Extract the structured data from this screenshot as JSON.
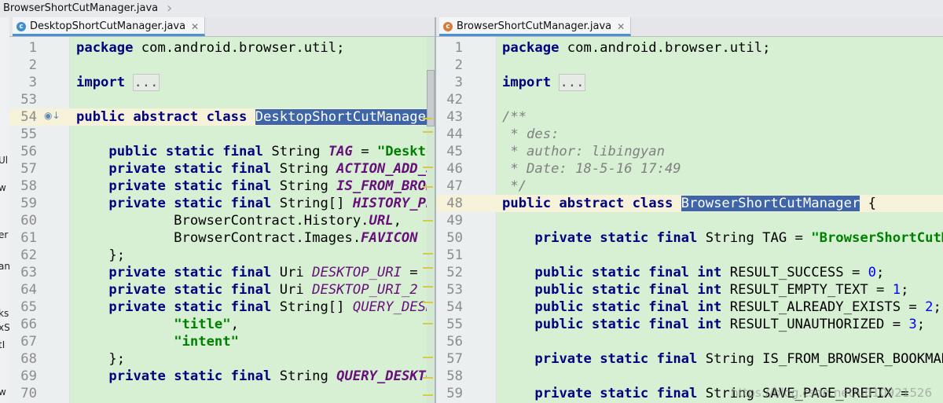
{
  "breadcrumb": {
    "file": "BrowserShortCutManager.java"
  },
  "left": {
    "tab": "DesktopShortCutManager.java",
    "lines": [
      {
        "n": "1",
        "html": "<span class=\"kw\">package</span> com.android.browser.util;"
      },
      {
        "n": "2",
        "html": ""
      },
      {
        "n": "3",
        "html": "<span class=\"kw\">import</span> <span class=\"fold\">...</span>"
      },
      {
        "n": "53",
        "html": ""
      },
      {
        "n": "54",
        "html": "<span class=\"kw\">public abstract class</span> <span class=\"sel\">DesktopShortCutManager</span>",
        "hl": true
      },
      {
        "n": "55",
        "html": ""
      },
      {
        "n": "56",
        "html": "    <span class=\"kw\">public static final</span> String <span class=\"fd\">TAG</span> = <span class=\"st\">\"DesktopShortCutManager\"</span>;"
      },
      {
        "n": "57",
        "html": "    <span class=\"kw\">private static final</span> String <span class=\"fd\">ACTION_ADD_SHORTCUT</span>"
      },
      {
        "n": "58",
        "html": "    <span class=\"kw\">private static final</span> String <span class=\"fd\">IS_FROM_BROWSER</span>"
      },
      {
        "n": "59",
        "html": "    <span class=\"kw\">private static final</span> String[] <span class=\"fd\">HISTORY_PROJECTION</span>"
      },
      {
        "n": "60",
        "html": "            BrowserContract.History.<span class=\"fd\">URL</span>,"
      },
      {
        "n": "61",
        "html": "            BrowserContract.Images.<span class=\"fd\">FAVICON</span>"
      },
      {
        "n": "62",
        "html": "    };"
      },
      {
        "n": "63",
        "html": "    <span class=\"kw\">private static final</span> Uri <span class=\"fdn\">DESKTOP_URI</span> ="
      },
      {
        "n": "64",
        "html": "    <span class=\"kw\">private static final</span> Uri <span class=\"fdn\">DESKTOP_URI_2</span>"
      },
      {
        "n": "65",
        "html": "    <span class=\"kw\">private static final</span> String[] <span class=\"fdn\">QUERY_DESKTOP</span>"
      },
      {
        "n": "66",
        "html": "            <span class=\"st\">\"title\"</span>,"
      },
      {
        "n": "67",
        "html": "            <span class=\"st\">\"intent\"</span>"
      },
      {
        "n": "68",
        "html": "    };"
      },
      {
        "n": "69",
        "html": "    <span class=\"kw\">private static final</span> String <span class=\"fd\">QUERY_DESKTOP</span>"
      },
      {
        "n": "70",
        "html": ""
      }
    ]
  },
  "right": {
    "tab": "BrowserShortCutManager.java",
    "lines": [
      {
        "n": "1",
        "html": "<span class=\"kw\">package</span> com.android.browser.util;"
      },
      {
        "n": "2",
        "html": ""
      },
      {
        "n": "3",
        "html": "<span class=\"kw\">import</span> <span class=\"fold\">...</span>"
      },
      {
        "n": "42",
        "html": ""
      },
      {
        "n": "43",
        "html": "<span class=\"cm\">/**</span>"
      },
      {
        "n": "44",
        "html": "<span class=\"cm\"> * des:</span>"
      },
      {
        "n": "45",
        "html": "<span class=\"cm\"> * author: libingyan</span>"
      },
      {
        "n": "46",
        "html": "<span class=\"cm\"> * Date: 18-5-16 17:49</span>"
      },
      {
        "n": "47",
        "html": "<span class=\"cm\"> */</span>"
      },
      {
        "n": "48",
        "html": "<span class=\"kw\">public abstract class</span> <span class=\"sel\">BrowserShortCutManager</span> {",
        "hl": true
      },
      {
        "n": "49",
        "html": ""
      },
      {
        "n": "50",
        "html": "    <span class=\"kw\">private static final</span> String TAG = <span class=\"st\">\"BrowserShortCutManager\"</span>;"
      },
      {
        "n": "51",
        "html": ""
      },
      {
        "n": "52",
        "html": "    <span class=\"kw\">public static final int</span> RESULT_SUCCESS = <span class=\"num\">0</span>;"
      },
      {
        "n": "53",
        "html": "    <span class=\"kw\">public static final int</span> RESULT_EMPTY_TEXT = <span class=\"num\">1</span>;"
      },
      {
        "n": "54",
        "html": "    <span class=\"kw\">public static final int</span> RESULT_ALREADY_EXISTS = <span class=\"num\">2</span>;"
      },
      {
        "n": "55",
        "html": "    <span class=\"kw\">public static final int</span> RESULT_UNAUTHORIZED = <span class=\"num\">3</span>;"
      },
      {
        "n": "56",
        "html": ""
      },
      {
        "n": "57",
        "html": "    <span class=\"kw\">private static final</span> String IS_FROM_BROWSER_BOOKMARK"
      },
      {
        "n": "58",
        "html": ""
      },
      {
        "n": "59",
        "html": "    <span class=\"kw\">private static final</span> String SAVE_PAGE_PREFIX = "
      }
    ]
  },
  "watermark": "https://blog.csdn.net/u010921526"
}
